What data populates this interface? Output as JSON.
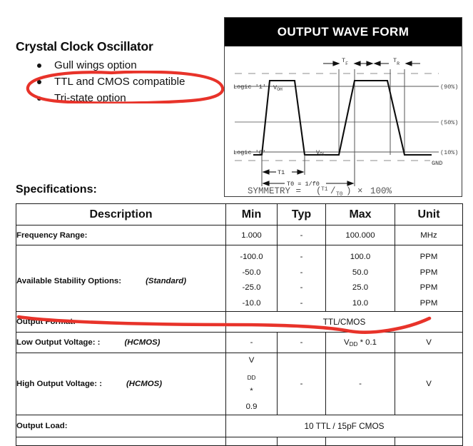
{
  "product": {
    "title": "Crystal Clock Oscillator",
    "features": [
      "Gull wings option",
      "TTL and CMOS compatible",
      "Tri-state option"
    ]
  },
  "annotations": {
    "color": "#E8332A",
    "ellipse_target": "TTL and CMOS compatible",
    "underline_target": "Output Format:"
  },
  "waveform": {
    "title": "OUTPUT WAVE FORM",
    "labels": {
      "logic_high": "Logic '1'",
      "logic_low": "Logic '0'",
      "voh": "V",
      "voh_sub": "OH",
      "vol": "V",
      "vol_sub": "OL",
      "gnd": "GND",
      "tf": "T",
      "tf_sub": "F",
      "tr": "T",
      "tr_sub": "R",
      "t1": "T1",
      "t0": "T0 = 1/f0",
      "pct90": "(90%)",
      "pct50": "(50%)",
      "pct10": "(10%)"
    },
    "formula": {
      "lhs": "SYMMETRY  = ",
      "open": "(",
      "num": "T1",
      "slash": "/",
      "den": "T0",
      "close": ")",
      "times": "×",
      "rhs": "100%"
    }
  },
  "specifications": {
    "heading": "Specifications:",
    "columns": [
      "Description",
      "Min",
      "Typ",
      "Max",
      "Unit"
    ],
    "rows": [
      {
        "description": "Frequency Range:",
        "qualifier": "",
        "min": "1.000",
        "typ": "-",
        "max": "100.000",
        "unit": "MHz",
        "span": null
      },
      {
        "description": "Available Stability Options:",
        "qualifier": "(Standard)",
        "min": [
          "-100.0",
          "-50.0",
          "-25.0",
          "-10.0"
        ],
        "typ": [
          "-",
          "-",
          "-",
          "-"
        ],
        "max": [
          "100.0",
          "50.0",
          "25.0",
          "10.0"
        ],
        "unit": [
          "PPM",
          "PPM",
          "PPM",
          "PPM"
        ],
        "span": null
      },
      {
        "description": "Output Format:",
        "qualifier": "",
        "span": "TTL/CMOS"
      },
      {
        "description": "Low Output Voltage: :",
        "qualifier": "(HCMOS)",
        "min": "-",
        "typ": "-",
        "max": "VDD * 0.1",
        "max_parts": {
          "v": "V",
          "sub": "DD",
          "rest": " * 0.1"
        },
        "unit": "V",
        "span": null
      },
      {
        "description": "High Output Voltage: :",
        "qualifier": "(HCMOS)",
        "min": "VDD * 0.9",
        "min_parts": {
          "v": "V",
          "sub": "DD",
          "rest": " *",
          "line2": "0.9"
        },
        "typ": "-",
        "max": "-",
        "unit": "V",
        "span": null
      },
      {
        "description": "Output Load:",
        "qualifier": "",
        "span": "10 TTL / 15pF CMOS"
      }
    ]
  }
}
